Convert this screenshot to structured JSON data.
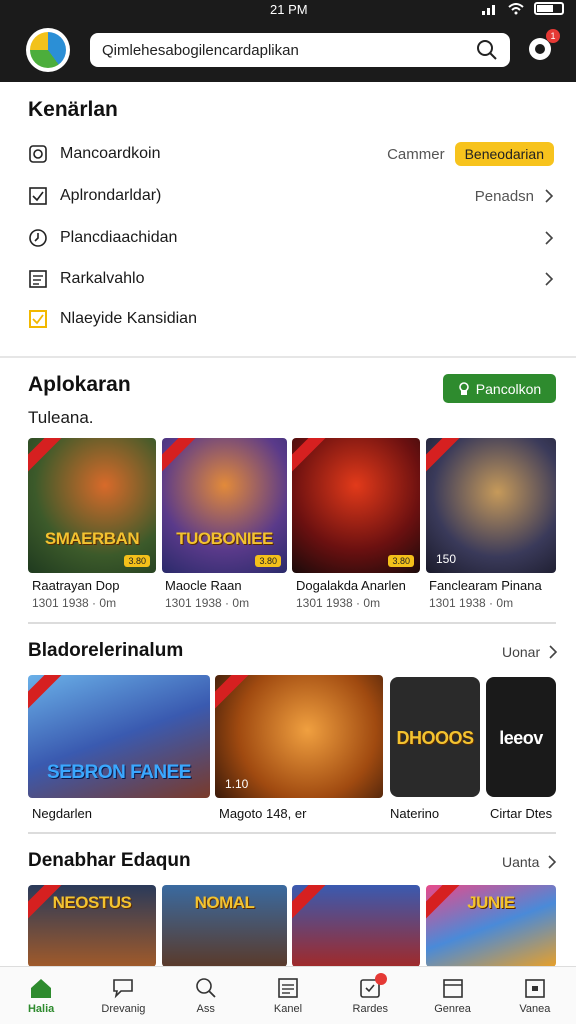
{
  "status": {
    "time": "21 PM"
  },
  "header": {
    "search_value": "Qimlehesabogilencardaplikan",
    "notif_count": "1"
  },
  "kenarlan": {
    "title": "Kenärlan",
    "items": [
      {
        "label": "Mancoardkoin",
        "right_text": "Cammer",
        "button": "Beneodarian"
      },
      {
        "label": "Aplrondarldar)",
        "right_text": "Penadsn"
      },
      {
        "label": "Plancdiaachidan"
      },
      {
        "label": "Rarkalvahlo"
      },
      {
        "label": "Nlaeyide Kansidian"
      }
    ]
  },
  "aplokaran": {
    "title": "Aplokaran",
    "button": "Pancolkon",
    "subtitle": "Tuleana.",
    "cards": [
      {
        "art": "SMAERBAN",
        "name": "Raatrayan Dop",
        "meta": "1301 1938 · 0m",
        "tag": "3.80"
      },
      {
        "art": "TUOBONIEE",
        "name": "Maocle Raan",
        "meta": "1301 1938 · 0m",
        "tag": "3.80"
      },
      {
        "art": "",
        "name": "Dogalakda Anarlen",
        "meta": "1301 1938 · 0m",
        "tag": "3.80"
      },
      {
        "art": "",
        "name": "Fanclearam Pinana",
        "meta": "1301 1938 · 0m",
        "tag": "150"
      }
    ]
  },
  "blodore": {
    "title": "Bladorelerinalum",
    "more": "Uonar",
    "cards": [
      {
        "art": "SEBRON FANEE",
        "name": "Negdarlen",
        "tag": ""
      },
      {
        "art": "",
        "name": "Magoto 148, er",
        "tag": "1.10"
      },
      {
        "art": "DHOOOS",
        "name": "Naterino",
        "tag": ""
      },
      {
        "art": "leeov",
        "name": "Cirtar Dtes",
        "tag": ""
      }
    ]
  },
  "denabhar": {
    "title": "Denabhar Edaqun",
    "more": "Uanta",
    "cards": [
      {
        "art": "NEOSTUS"
      },
      {
        "art": "NOMAL"
      },
      {
        "art": ""
      },
      {
        "art": "JUNIE"
      }
    ]
  },
  "nav": [
    {
      "label": "Halia",
      "icon": "home-icon"
    },
    {
      "label": "Drevanig",
      "icon": "chat-icon"
    },
    {
      "label": "Ass",
      "icon": "search-icon"
    },
    {
      "label": "Kanel",
      "icon": "list-icon"
    },
    {
      "label": "Rardes",
      "icon": "tag-icon"
    },
    {
      "label": "Genrea",
      "icon": "calendar-icon"
    },
    {
      "label": "Vanea",
      "icon": "box-icon"
    }
  ],
  "colors": {
    "accent_green": "#2e8b2e",
    "accent_yellow": "#f7c31d",
    "header_dark": "#1b1b1b"
  }
}
